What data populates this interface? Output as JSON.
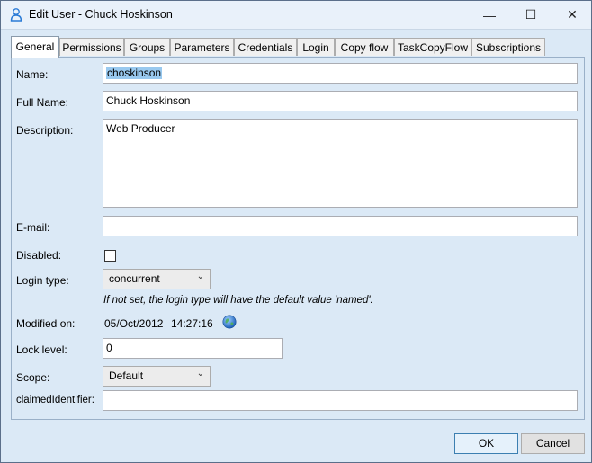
{
  "window": {
    "title": "Edit User - Chuck Hoskinson",
    "minimize_glyph": "—",
    "maximize_glyph": "☐",
    "close_glyph": "✕"
  },
  "tabs": [
    {
      "label": "General",
      "active": true
    },
    {
      "label": "Permissions"
    },
    {
      "label": "Groups"
    },
    {
      "label": "Parameters"
    },
    {
      "label": "Credentials"
    },
    {
      "label": "Login"
    },
    {
      "label": "Copy flow"
    },
    {
      "label": "TaskCopyFlow"
    },
    {
      "label": "Subscriptions"
    }
  ],
  "form": {
    "name_label": "Name:",
    "name_value": "choskinson",
    "fullname_label": "Full Name:",
    "fullname_value": "Chuck Hoskinson",
    "description_label": "Description:",
    "description_value": "Web Producer",
    "email_label": "E-mail:",
    "email_value": "",
    "disabled_label": "Disabled:",
    "logintype_label": "Login type:",
    "logintype_value": "concurrent",
    "logintype_hint": "If not set, the login type will have the default value 'named'.",
    "modified_label": "Modified on:",
    "modified_date": "05/Oct/2012",
    "modified_time": "14:27:16",
    "locklevel_label": "Lock level:",
    "locklevel_value": "0",
    "scope_label": "Scope:",
    "scope_value": "Default",
    "claimed_label": "claimedIdentifier:",
    "claimed_value": ""
  },
  "buttons": {
    "ok": "OK",
    "cancel": "Cancel"
  },
  "icons": {
    "title": "user-icon",
    "globe": "globe-icon"
  }
}
